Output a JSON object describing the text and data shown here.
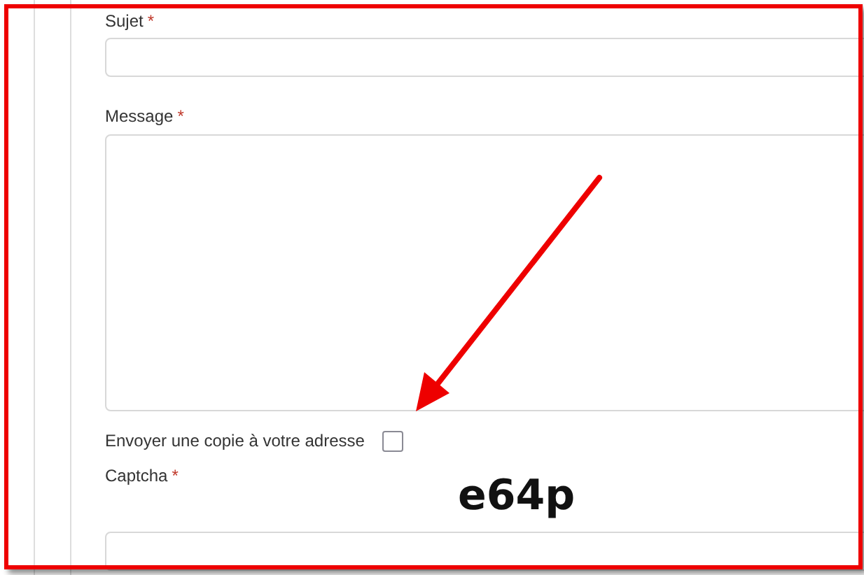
{
  "form": {
    "fields": [
      {
        "kind": "text",
        "label": "Sujet",
        "mark": "*"
      },
      {
        "kind": "textarea",
        "label": "Message",
        "mark": "*"
      },
      {
        "kind": "checkbox",
        "label": "Envoyer une copie à votre adresse",
        "checked": false
      },
      {
        "kind": "captcha",
        "label": "Captcha",
        "mark": "*",
        "code": "e64p"
      },
      {
        "kind": "text"
      }
    ]
  },
  "annotation": {
    "kind": "arrow"
  }
}
